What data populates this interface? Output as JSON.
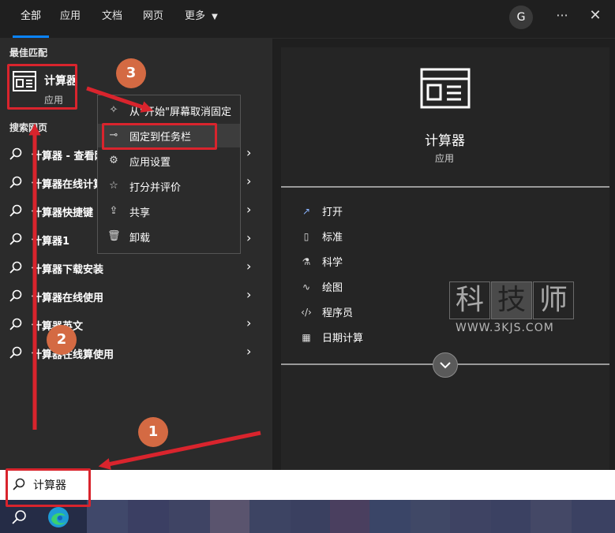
{
  "topbar": {
    "tabs": [
      "全部",
      "应用",
      "文档",
      "网页",
      "更多"
    ],
    "avatar": "G",
    "more_glyph": "···",
    "close_glyph": "✕"
  },
  "left": {
    "best_match_header": "最佳匹配",
    "best_match": {
      "title": "计算器",
      "subtitle": "应用"
    },
    "web_header": "搜索网页",
    "suggestions": [
      "计算器 - 查看网络搜索结果",
      "计算器在线计算器",
      "计算器快捷键",
      "计算器1",
      "计算器下载安装",
      "计算器在线使用",
      "计算器英文",
      "计算器在线算使用"
    ]
  },
  "context_menu": {
    "items": [
      {
        "label": "从\"开始\"屏幕取消固定",
        "icon": "unpin-icon"
      },
      {
        "label": "固定到任务栏",
        "icon": "pin-taskbar-icon"
      },
      {
        "label": "应用设置",
        "icon": "gear-icon"
      },
      {
        "label": "打分并评价",
        "icon": "rate-icon"
      },
      {
        "label": "共享",
        "icon": "share-icon"
      },
      {
        "label": "卸载",
        "icon": "trash-icon"
      }
    ]
  },
  "right": {
    "title": "计算器",
    "subtitle": "应用",
    "actions": [
      {
        "label": "打开",
        "icon": "open-icon"
      },
      {
        "label": "标准",
        "icon": "standard-calc-icon"
      },
      {
        "label": "科学",
        "icon": "science-icon"
      },
      {
        "label": "绘图",
        "icon": "graph-icon"
      },
      {
        "label": "程序员",
        "icon": "code-icon"
      },
      {
        "label": "日期计算",
        "icon": "calendar-icon"
      }
    ]
  },
  "watermark": {
    "chars": [
      "科",
      "技",
      "师"
    ],
    "url": "WWW.3KJS.COM"
  },
  "search": {
    "value": "计算器"
  },
  "annotations": {
    "badges": [
      "1",
      "2",
      "3"
    ]
  },
  "colors": {
    "accent": "#0a84ff",
    "annotation_red": "#d9242d",
    "badge": "#d46a43"
  }
}
